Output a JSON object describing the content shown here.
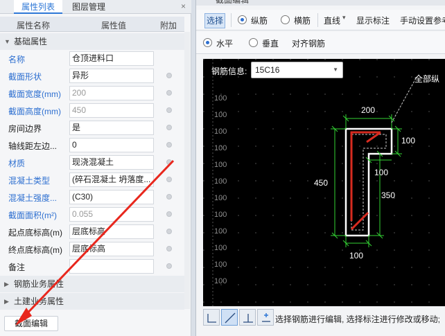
{
  "left_panel": {
    "tabs": [
      "属性列表",
      "图层管理"
    ],
    "close_icon": "×",
    "columns": [
      "属性名称",
      "属性值",
      "附加"
    ],
    "groups": {
      "basic": "基础属性",
      "rebar_business": "钢筋业务属性",
      "civil_business": "土建业务属性"
    },
    "rows": [
      {
        "label": "名称",
        "value": "仓顶进料口",
        "blue": true,
        "gray_value": false,
        "has_check": false
      },
      {
        "label": "截面形状",
        "value": "异形",
        "blue": true,
        "gray_value": false,
        "has_check": true
      },
      {
        "label": "截面宽度(mm)",
        "value": "200",
        "blue": true,
        "gray_value": true,
        "has_check": true
      },
      {
        "label": "截面高度(mm)",
        "value": "450",
        "blue": true,
        "gray_value": true,
        "has_check": true
      },
      {
        "label": "房间边界",
        "value": "是",
        "blue": false,
        "gray_value": false,
        "has_check": true
      },
      {
        "label": "轴线距左边...",
        "value": "0",
        "blue": false,
        "gray_value": false,
        "has_check": true
      },
      {
        "label": "材质",
        "value": "现浇混凝土",
        "blue": true,
        "gray_value": false,
        "has_check": true
      },
      {
        "label": "混凝土类型",
        "value": "(碎石混凝土 坍落度...",
        "blue": true,
        "gray_value": false,
        "has_check": true
      },
      {
        "label": "混凝土强度...",
        "value": "(C30)",
        "blue": true,
        "gray_value": false,
        "has_check": true
      },
      {
        "label": "截面面积(m²)",
        "value": "0.055",
        "blue": true,
        "gray_value": true,
        "has_check": true
      },
      {
        "label": "起点底标高(m)",
        "value": "层底标高",
        "blue": false,
        "gray_value": false,
        "has_check": true
      },
      {
        "label": "终点底标高(m)",
        "value": "层底标高",
        "blue": false,
        "gray_value": false,
        "has_check": true
      },
      {
        "label": "备注",
        "value": "",
        "blue": false,
        "gray_value": false,
        "has_check": true
      }
    ],
    "bottom_button": "截面编辑"
  },
  "right_panel": {
    "title": "截面编辑",
    "toolbar1": {
      "select": "选择",
      "longitudinal": "纵筋",
      "stirrup": "横筋",
      "line": "直线",
      "line_caret": "▾",
      "show_annotation": "显示标注",
      "manual_cover": "手动设置参考"
    },
    "toolbar2": {
      "horizontal": "水平",
      "vertical": "垂直",
      "align_rebar": "对齐钢筋"
    },
    "rebar_info_label": "钢筋信息:",
    "rebar_info_value": "15C16",
    "all_longitudinal": "全部纵",
    "grid_labels": [
      "100",
      "100",
      "100",
      "100",
      "100",
      "100",
      "100",
      "100",
      "100",
      "100",
      "100",
      "100"
    ],
    "dimensions": {
      "top": "200",
      "right_top": "100",
      "inner": "100",
      "left": "450",
      "right": "350",
      "bottom": "100"
    },
    "status": "选择钢筋进行编辑, 选择标注进行修改或移动;"
  },
  "colors": {
    "accent": "#2d77d6",
    "arrow": "#e8271d",
    "canvas": "#000000",
    "dimension": "#34d334",
    "rebar": "#d72b20"
  }
}
